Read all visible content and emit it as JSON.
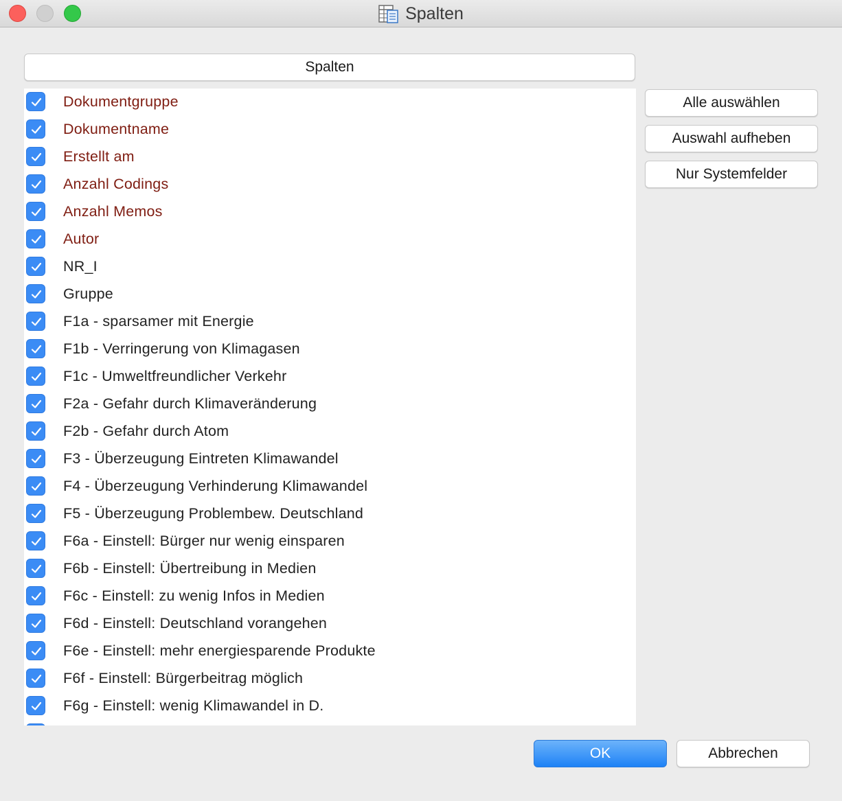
{
  "window": {
    "title": "Spalten",
    "icon": "table-columns-icon"
  },
  "list_header": {
    "label": "Spalten"
  },
  "columns": [
    {
      "label": "Dokumentgruppe",
      "checked": true,
      "system": true
    },
    {
      "label": "Dokumentname",
      "checked": true,
      "system": true
    },
    {
      "label": "Erstellt am",
      "checked": true,
      "system": true
    },
    {
      "label": "Anzahl Codings",
      "checked": true,
      "system": true
    },
    {
      "label": "Anzahl Memos",
      "checked": true,
      "system": true
    },
    {
      "label": "Autor",
      "checked": true,
      "system": true
    },
    {
      "label": "NR_I",
      "checked": true,
      "system": false
    },
    {
      "label": "Gruppe",
      "checked": true,
      "system": false
    },
    {
      "label": "F1a - sparsamer mit Energie",
      "checked": true,
      "system": false
    },
    {
      "label": "F1b - Verringerung von Klimagasen",
      "checked": true,
      "system": false
    },
    {
      "label": "F1c - Umweltfreundlicher Verkehr",
      "checked": true,
      "system": false
    },
    {
      "label": "F2a - Gefahr durch Klimaveränderung",
      "checked": true,
      "system": false
    },
    {
      "label": "F2b - Gefahr durch Atom",
      "checked": true,
      "system": false
    },
    {
      "label": "F3 - Überzeugung Eintreten Klimawandel",
      "checked": true,
      "system": false
    },
    {
      "label": "F4 - Überzeugung Verhinderung Klimawandel",
      "checked": true,
      "system": false
    },
    {
      "label": "F5 - Überzeugung Problembew. Deutschland",
      "checked": true,
      "system": false
    },
    {
      "label": "F6a - Einstell: Bürger nur wenig einsparen",
      "checked": true,
      "system": false
    },
    {
      "label": "F6b - Einstell: Übertreibung in Medien",
      "checked": true,
      "system": false
    },
    {
      "label": "F6c - Einstell: zu wenig Infos in Medien",
      "checked": true,
      "system": false
    },
    {
      "label": "F6d - Einstell: Deutschland vorangehen",
      "checked": true,
      "system": false
    },
    {
      "label": "F6e - Einstell: mehr energiesparende Produkte",
      "checked": true,
      "system": false
    },
    {
      "label": "F6f - Einstell: Bürgerbeitrag möglich",
      "checked": true,
      "system": false
    },
    {
      "label": "F6g - Einstell: wenig Klimawandel in D.",
      "checked": true,
      "system": false
    },
    {
      "label": "",
      "checked": true,
      "system": false
    }
  ],
  "side_buttons": {
    "select_all": "Alle auswählen",
    "deselect": "Auswahl aufheben",
    "system_only": "Nur Systemfelder"
  },
  "footer": {
    "ok": "OK",
    "cancel": "Abbrechen"
  },
  "colors": {
    "accent": "#3b8cf5",
    "system_field_text": "#7f1d12",
    "ok_button": "#1e82f6"
  }
}
